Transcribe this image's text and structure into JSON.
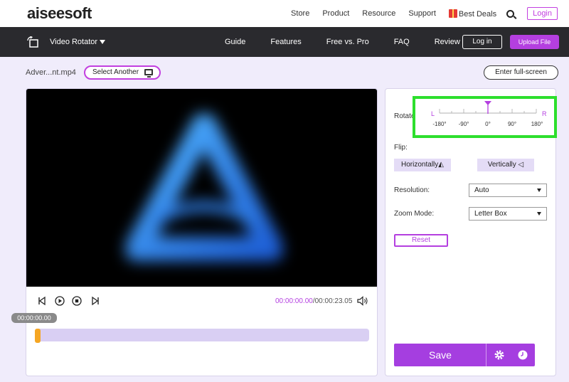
{
  "topnav": {
    "logo": "aiseesoft",
    "links": [
      "Store",
      "Product",
      "Resource",
      "Support"
    ],
    "deals": "Best Deals",
    "login": "Login"
  },
  "toolbar": {
    "tool_name": "Video Rotator",
    "nav": [
      "Guide",
      "Features",
      "Free vs. Pro",
      "FAQ",
      "Review"
    ],
    "login": "Log in",
    "upload": "Upload File"
  },
  "file": {
    "name": "Adver...nt.mp4",
    "select_another": "Select Another",
    "fullscreen": "Enter full-screen"
  },
  "player": {
    "current_time": "00:00:00.00",
    "total_time": "/00:00:23.05",
    "timestamp": "00:00:00.00",
    "progress_fraction": 0
  },
  "settings": {
    "rotate_label": "Rotate",
    "ruler": {
      "left": "L",
      "right": "R",
      "ticks": [
        "-180°",
        "-90°",
        "0°",
        "90°",
        "180°"
      ],
      "value_deg": 0
    },
    "flip_label": "Flip:",
    "flip_h": "Horizontally",
    "flip_v": "Vertically",
    "resolution_label": "Resolution:",
    "resolution_value": "Auto",
    "zoom_label": "Zoom Mode:",
    "zoom_value": "Letter Box",
    "reset": "Reset",
    "save": "Save"
  },
  "colors": {
    "accent": "#b43fe0",
    "highlight": "#2ddf2d",
    "scrubber": "#f5a623"
  }
}
